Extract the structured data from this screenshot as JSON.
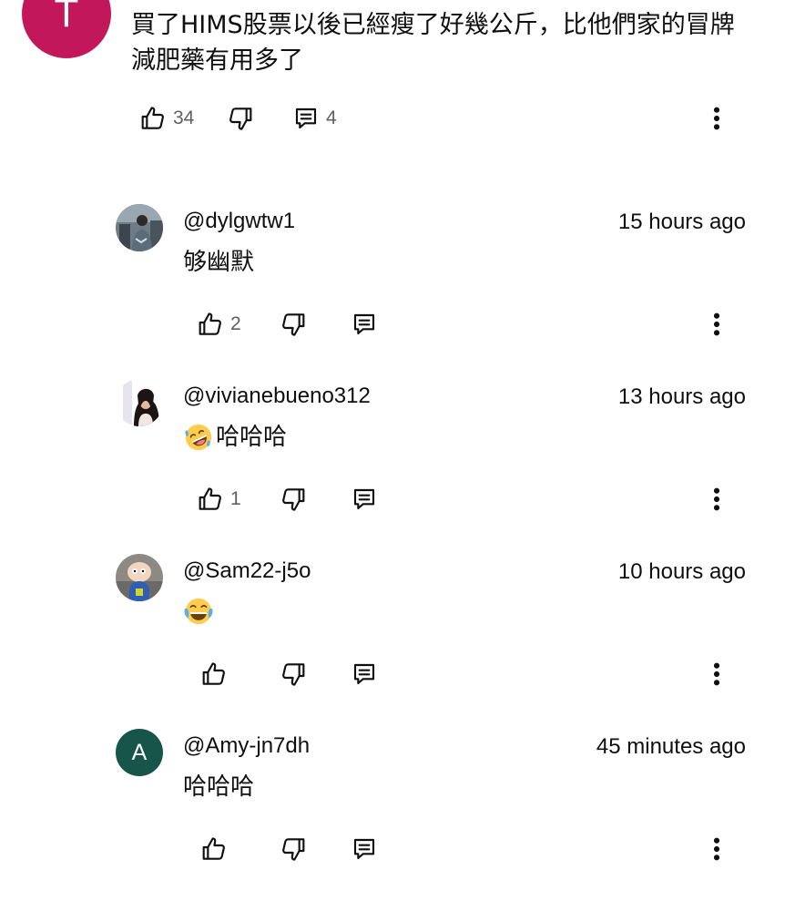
{
  "parent_comment": {
    "avatar_letter": "T",
    "avatar_color": "#c2185b",
    "text": "買了HIMS股票以後已經瘦了好幾公斤，比他們家的冒牌減肥藥有用多了",
    "like_count": "34",
    "reply_count": "4"
  },
  "replies": [
    {
      "handle": "@dylgwtw1",
      "time": "15 hours ago",
      "text": "够幽默",
      "emoji": "",
      "like_count": "2"
    },
    {
      "handle": "@vivianebueno312",
      "time": "13 hours ago",
      "text": "哈哈哈",
      "emoji": "rolling-on-floor-laughing",
      "like_count": "1"
    },
    {
      "handle": "@Sam22-j5o",
      "time": "10 hours ago",
      "text": "",
      "emoji": "tears-of-joy",
      "like_count": ""
    },
    {
      "handle": "@Amy-jn7dh",
      "time": "45 minutes ago",
      "text": "哈哈哈",
      "emoji": "",
      "avatar_letter": "A",
      "avatar_color": "#17544a",
      "like_count": ""
    }
  ],
  "icons": {
    "like": "thumb-up-icon",
    "dislike": "thumb-down-icon",
    "reply": "comment-icon",
    "more": "more-vertical-icon"
  }
}
